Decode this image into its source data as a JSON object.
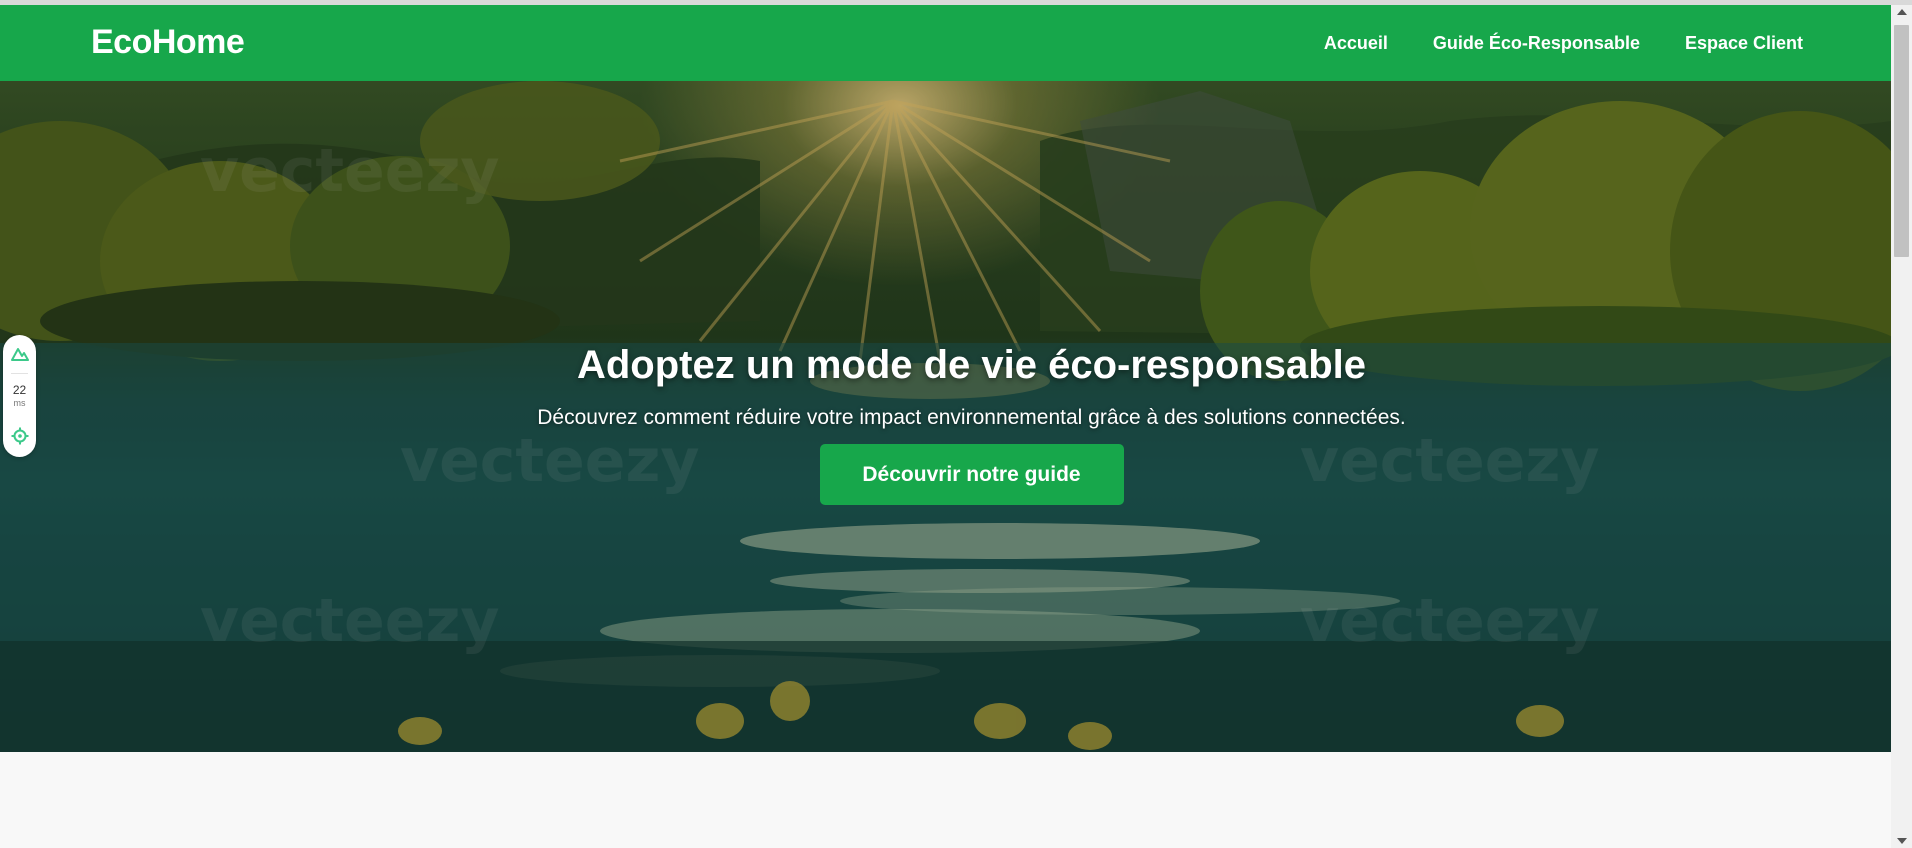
{
  "brand": {
    "name": "EcoHome",
    "color": "#17a74b"
  },
  "nav": {
    "items": [
      {
        "label": "Accueil"
      },
      {
        "label": "Guide Éco-Responsable"
      },
      {
        "label": "Espace Client"
      }
    ]
  },
  "hero": {
    "title": "Adoptez un mode de vie éco-responsable",
    "subtitle": "Découvrez comment réduire votre impact environnemental grâce à des solutions connectées.",
    "cta_label": "Découvrir notre guide",
    "watermark": "vecteezy",
    "background_icon": "forest-lake-sunrise-image"
  },
  "perf_widget": {
    "value": "22",
    "unit": "ms",
    "icons": [
      "mountain-logo-icon",
      "crosshair-icon"
    ],
    "accent": "#3cc98a"
  },
  "scrollbar": {
    "thumb_fraction": 0.27
  }
}
